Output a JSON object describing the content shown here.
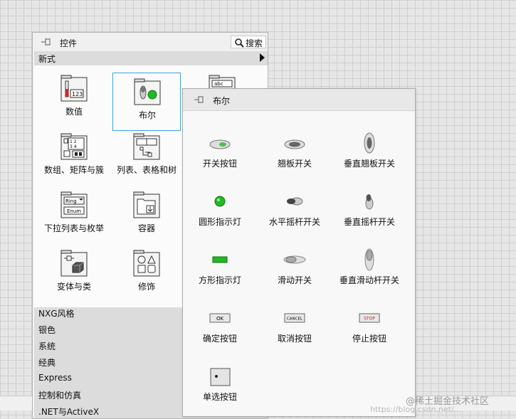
{
  "palette": {
    "title": "控件",
    "search_label": "搜索",
    "category": "新式",
    "items": [
      {
        "label": "数值",
        "icon": "numeric-icon"
      },
      {
        "label": "布尔",
        "icon": "boolean-icon"
      },
      {
        "label": "",
        "icon": "string-path-icon"
      },
      {
        "label": "数组、矩阵与簇",
        "icon": "array-matrix-cluster-icon"
      },
      {
        "label": "列表、表格和树",
        "icon": "list-table-tree-icon"
      },
      {
        "label": "下拉列表与枚举",
        "icon": "ring-enum-icon"
      },
      {
        "label": "容器",
        "icon": "containers-icon"
      },
      {
        "label": "变体与类",
        "icon": "variant-class-icon"
      },
      {
        "label": "修饰",
        "icon": "decorations-icon"
      }
    ],
    "folders": [
      "NXG风格",
      "银色",
      "系统",
      "经典",
      "Express",
      "控制和仿真",
      ".NET与ActiveX"
    ]
  },
  "subpalette": {
    "title": "布尔",
    "items": [
      {
        "label": "开关按钮",
        "icon": "push-button-icon"
      },
      {
        "label": "翘板开关",
        "icon": "rocker-switch-icon"
      },
      {
        "label": "垂直翘板开关",
        "icon": "vertical-rocker-icon"
      },
      {
        "label": "圆形指示灯",
        "icon": "round-led-icon"
      },
      {
        "label": "水平摇杆开关",
        "icon": "horizontal-toggle-icon"
      },
      {
        "label": "垂直摇杆开关",
        "icon": "vertical-toggle-icon"
      },
      {
        "label": "方形指示灯",
        "icon": "square-led-icon"
      },
      {
        "label": "滑动开关",
        "icon": "slide-switch-icon"
      },
      {
        "label": "垂直滑动杆开关",
        "icon": "vertical-slide-icon"
      },
      {
        "label": "确定按钮",
        "icon": "ok-button-icon",
        "text": "OK"
      },
      {
        "label": "取消按钮",
        "icon": "cancel-button-icon",
        "text": "CANCEL"
      },
      {
        "label": "停止按钮",
        "icon": "stop-button-icon",
        "text": "STOP"
      },
      {
        "label": "单选按钮",
        "icon": "radio-buttons-icon"
      }
    ]
  },
  "watermark": "@稀土掘金技术社区",
  "watermark_url": "https://blog.csdn.net/..."
}
